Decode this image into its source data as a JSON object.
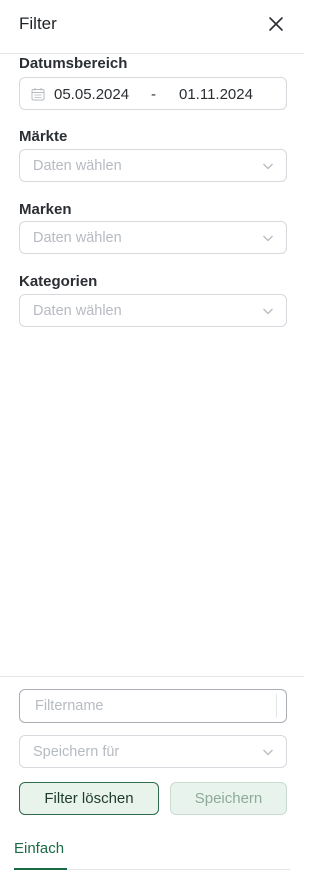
{
  "header": {
    "title": "Filter",
    "close_icon": "close-icon"
  },
  "date_range": {
    "label": "Datumsbereich",
    "start": "05.05.2024",
    "separator": "-",
    "end": "01.11.2024",
    "icon": "calendar-icon"
  },
  "markets": {
    "label": "Märkte",
    "placeholder": "Daten wählen"
  },
  "brands": {
    "label": "Marken",
    "placeholder": "Daten wählen"
  },
  "categories": {
    "label": "Kategorien",
    "placeholder": "Daten wählen"
  },
  "footer": {
    "filter_name_placeholder": "Filtername",
    "save_for_placeholder": "Speichern für",
    "clear_label": "Filter löschen",
    "save_label": "Speichern"
  },
  "tabs": [
    {
      "label": "Einfach",
      "active": true
    }
  ],
  "colors": {
    "accent": "#1a6a46",
    "accent_bg": "#e8f3ec",
    "placeholder": "#b6bbc1",
    "border": "#d6d9dd"
  }
}
